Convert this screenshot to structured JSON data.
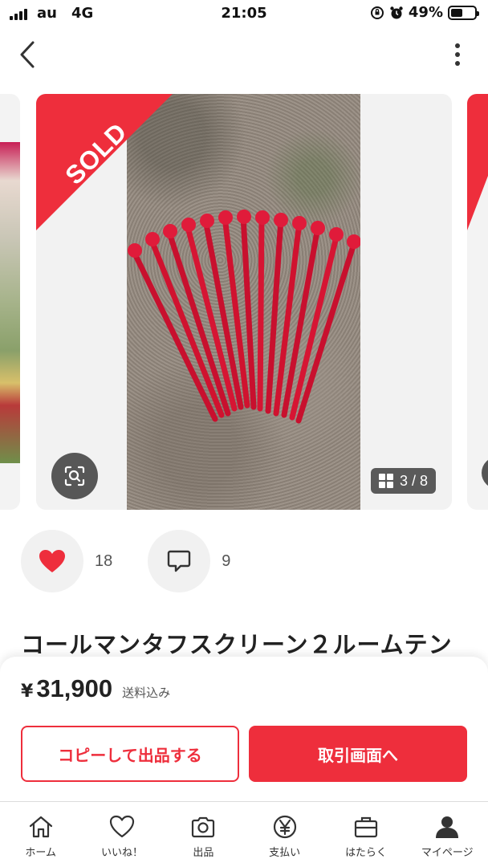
{
  "status_bar": {
    "carrier": "au",
    "network": "4G",
    "time": "21:05",
    "battery": "49%",
    "battery_level": 0.49
  },
  "gallery": {
    "sold_label": "SOLD",
    "counter": "3 / 8",
    "current_image": 3,
    "total_images": 8
  },
  "actions": {
    "like_count": "18",
    "comment_count": "9"
  },
  "item": {
    "title": "コールマンタフスクリーン２ルームテン"
  },
  "purchase": {
    "currency": "¥",
    "price": "31,900",
    "shipping_note": "送料込み",
    "copy_button_label": "コピーして出品する",
    "trade_button_label": "取引画面へ"
  },
  "tab_bar": {
    "items": [
      {
        "label": "ホーム",
        "icon": "home-icon"
      },
      {
        "label": "いいね！",
        "icon": "heart-outline-icon"
      },
      {
        "label": "出品",
        "icon": "camera-icon"
      },
      {
        "label": "支払い",
        "icon": "yen-circle-icon"
      },
      {
        "label": "はたらく",
        "icon": "briefcase-icon"
      },
      {
        "label": "マイページ",
        "icon": "person-icon"
      }
    ]
  },
  "colors": {
    "accent": "#ee2e3c",
    "button_grey": "#575757",
    "surface": "#f2f2f2"
  }
}
